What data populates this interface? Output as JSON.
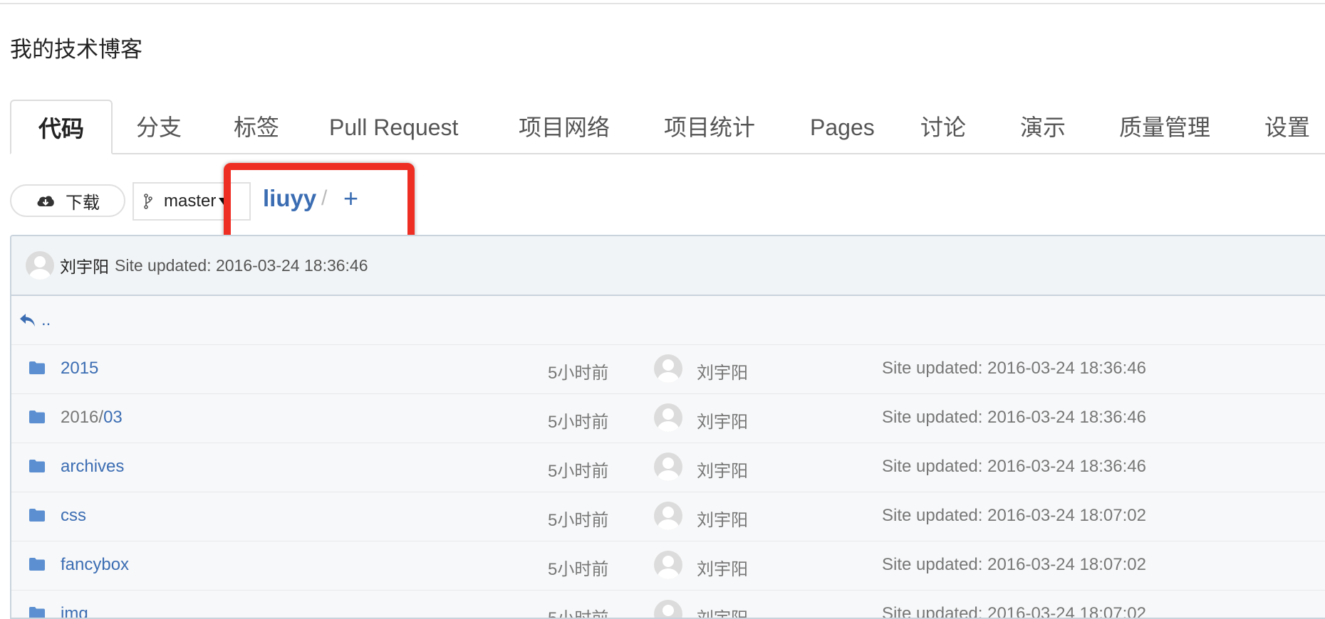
{
  "page_title": "我的技术博客",
  "tabs": [
    {
      "label": "代码",
      "active": true
    },
    {
      "label": "分支"
    },
    {
      "label": "标签"
    },
    {
      "label": "Pull Request"
    },
    {
      "label": "项目网络"
    },
    {
      "label": "项目统计"
    },
    {
      "label": "Pages"
    },
    {
      "label": "讨论"
    },
    {
      "label": "演示"
    },
    {
      "label": "质量管理"
    },
    {
      "label": "设置"
    }
  ],
  "toolbar": {
    "download_label": "下载",
    "branch": "master",
    "repo": "liuyy",
    "separator": "/",
    "add": "+"
  },
  "commit": {
    "author": "刘宇阳",
    "message": "Site updated: 2016-03-24 18:36:46"
  },
  "parent_link": "..",
  "files": [
    {
      "name": "2015",
      "time": "5小时前",
      "author": "刘宇阳",
      "message": "Site updated: 2016-03-24 18:36:46"
    },
    {
      "name_prefix": "2016/",
      "name": "03",
      "time": "5小时前",
      "author": "刘宇阳",
      "message": "Site updated: 2016-03-24 18:36:46"
    },
    {
      "name": "archives",
      "time": "5小时前",
      "author": "刘宇阳",
      "message": "Site updated: 2016-03-24 18:36:46"
    },
    {
      "name": "css",
      "time": "5小时前",
      "author": "刘宇阳",
      "message": "Site updated: 2016-03-24 18:07:02"
    },
    {
      "name": "fancybox",
      "time": "5小时前",
      "author": "刘宇阳",
      "message": "Site updated: 2016-03-24 18:07:02"
    },
    {
      "name": "img",
      "time": "5小时前",
      "author": "刘宇阳",
      "message": "Site updated: 2016-03-24 18:07:02"
    }
  ],
  "colors": {
    "link": "#3b6db3",
    "highlight": "#ef2e23",
    "folder": "#5b8fd1"
  }
}
